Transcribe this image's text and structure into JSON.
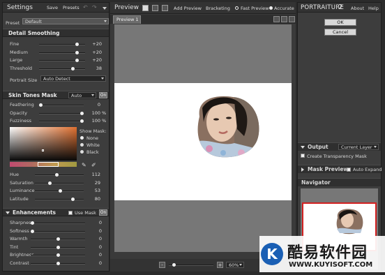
{
  "left": {
    "header": {
      "title": "Settings",
      "save": "Save",
      "presets": "Presets"
    },
    "preset": {
      "label": "Preset",
      "value": "Default"
    },
    "detail": {
      "title": "Detail Smoothing",
      "rows": [
        {
          "label": "Fine",
          "value": "+20",
          "level": 0.85
        },
        {
          "label": "Medium",
          "value": "+20",
          "level": 0.85
        },
        {
          "label": "Large",
          "value": "+20",
          "level": 0.85
        },
        {
          "label": "Threshold",
          "value": "38",
          "level": 0.75
        }
      ],
      "portrait_size_label": "Portrait Size",
      "portrait_size_value": "Auto Detect"
    },
    "skin": {
      "title": "Skin Tones Mask",
      "mode": "Auto",
      "on": "On",
      "rows": [
        {
          "label": "Feathering",
          "value": "0",
          "level": 0.0
        },
        {
          "label": "Opacity",
          "value": "100",
          "unit": "%",
          "level": 1.0
        },
        {
          "label": "Fuzziness",
          "value": "100",
          "unit": "%",
          "level": 1.0
        }
      ],
      "show_mask": {
        "label": "Show Mask:",
        "options": [
          "None",
          "White",
          "Black"
        ],
        "selected": 0
      },
      "color_rows": [
        {
          "label": "Hue",
          "value": "112",
          "level": 0.44
        },
        {
          "label": "Saturation",
          "value": "29",
          "level": 0.29
        },
        {
          "label": "Luminance",
          "value": "53",
          "level": 0.53
        },
        {
          "label": "Latitude",
          "value": "80",
          "level": 0.8
        }
      ]
    },
    "enh": {
      "title": "Enhancements",
      "use_mask": "Use Mask",
      "on": "On",
      "rows": [
        {
          "label": "Sharpness",
          "value": "0",
          "level": 0.0
        },
        {
          "label": "Softness",
          "value": "0",
          "level": 0.0
        },
        {
          "label": "Warmth",
          "value": "0",
          "level": 0.5
        },
        {
          "label": "Tint",
          "value": "0",
          "level": 0.5
        },
        {
          "label": "Brightness",
          "value": "0",
          "level": 0.5
        },
        {
          "label": "Contrast",
          "value": "0",
          "level": 0.5
        }
      ]
    }
  },
  "center": {
    "title": "Preview",
    "add_preview": "Add Preview",
    "bracketing": "Bracketing",
    "fast_preview": "Fast Preview",
    "accurate": "Accurate",
    "tab": "Preview 1",
    "zoom": "60%",
    "zoom_level": 0.6
  },
  "right": {
    "brand": "PORTRAITURE",
    "version": "2",
    "about": "About",
    "help": "Help",
    "ok": "OK",
    "cancel": "Cancel",
    "output": {
      "title": "Output",
      "value": "Current Layer",
      "transparency": "Create Transparency Mask"
    },
    "mask_preview": {
      "title": "Mask Preview",
      "auto_expand": "Auto Expand"
    },
    "navigator": {
      "title": "Navigator"
    }
  },
  "watermark": {
    "letter": "K",
    "cn": "酷易软件园",
    "url": "WWW.KUYISOFT.COM"
  },
  "colors": {
    "accent": "#e07030",
    "nav_border": "#d22020"
  }
}
